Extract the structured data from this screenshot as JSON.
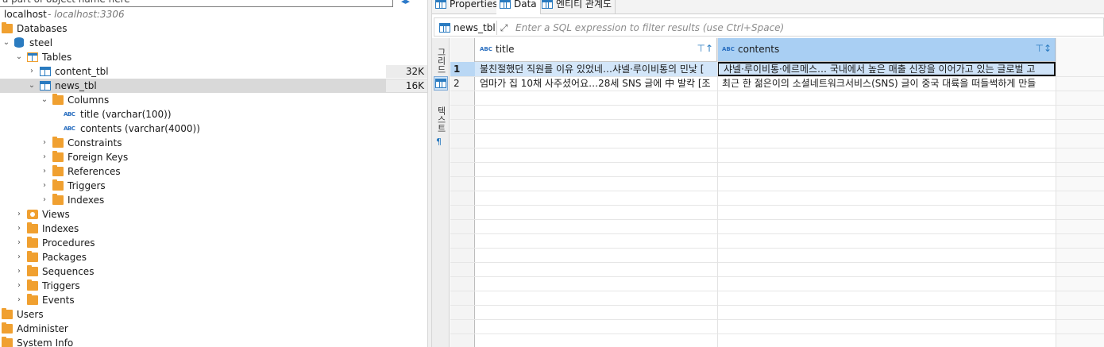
{
  "navigator": {
    "filter_placeholder": "a part of object name here",
    "connection": {
      "name": "localhost",
      "host": " - localhost:3306"
    },
    "databases_label": "Databases",
    "schema": "steel",
    "tables_label": "Tables",
    "tables": [
      {
        "name": "content_tbl",
        "size": "32K"
      },
      {
        "name": "news_tbl",
        "size": "16K"
      }
    ],
    "columns_label": "Columns",
    "columns": [
      "title (varchar(100))",
      "contents (varchar(4000))"
    ],
    "table_children": [
      "Constraints",
      "Foreign Keys",
      "References",
      "Triggers",
      "Indexes"
    ],
    "schema_children": [
      "Views",
      "Indexes",
      "Procedures",
      "Packages",
      "Sequences",
      "Triggers",
      "Events"
    ],
    "root_items": [
      "Users",
      "Administer",
      "System Info"
    ]
  },
  "editor": {
    "tabs": [
      {
        "label": "Properties",
        "icon": "properties-icon"
      },
      {
        "label": "Data",
        "icon": "data-grid-icon"
      },
      {
        "label": "엔티티 관계도",
        "icon": "er-diagram-icon"
      }
    ],
    "active_tab": "Data",
    "table_chip": "news_tbl",
    "filter_placeholder": "Enter a SQL expression to filter results (use Ctrl+Space)",
    "side_labels": {
      "grid": "그리드",
      "text": "텍스트"
    }
  },
  "grid": {
    "columns": [
      {
        "name": "title",
        "type_badge": "ABC"
      },
      {
        "name": "contents",
        "type_badge": "ABC"
      }
    ],
    "rows": [
      {
        "num": "1",
        "title": "불친절했던 직원를 이유 있었네…샤넬·루이비통의 민낯 [",
        "contents": "샤넬·루이비통·에르메스… 국내에서 높은 매출 신장을 이어가고 있는 글로벌 고"
      },
      {
        "num": "2",
        "title": "엄마가 집 10채 사주셨어요…28세 SNS 글에 中 발칵 [조",
        "contents": "최근 한 젊은이의 소셜네트워크서비스(SNS) 글이 중국 대륙을 떠들썩하게 만들"
      }
    ],
    "selected_row": 1
  },
  "colors": {
    "accent": "#2a7bc0",
    "folder": "#f0a030",
    "selected_header": "#a9cff3",
    "tree_selection": "#d9d9d9"
  }
}
